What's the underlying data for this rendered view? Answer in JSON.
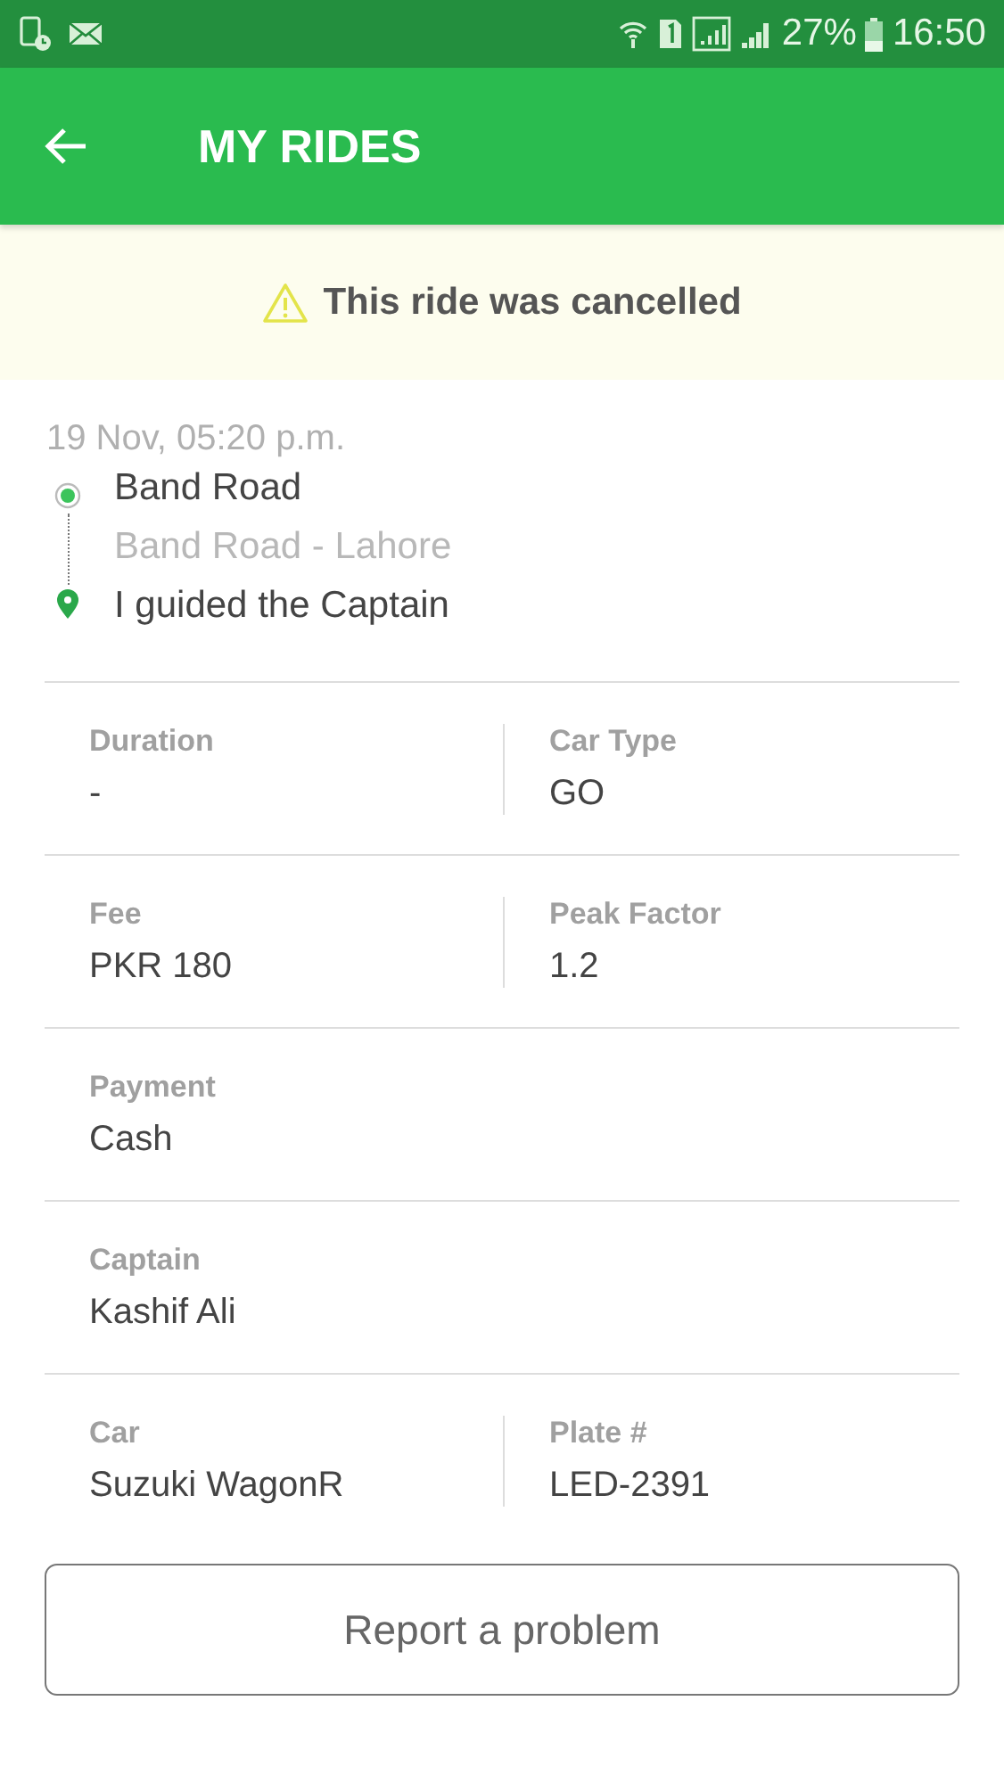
{
  "status_bar": {
    "battery": "27%",
    "time": "16:50"
  },
  "app_bar": {
    "title": "MY RIDES"
  },
  "notice": {
    "text": "This ride was cancelled"
  },
  "ride": {
    "date": "19 Nov, 05:20 p.m.",
    "pickup": "Band Road",
    "pickup_detail": "Band Road - Lahore",
    "dropoff": "I guided the Captain"
  },
  "details": [
    {
      "cells": [
        {
          "label": "Duration",
          "value": "-"
        },
        {
          "label": "Car Type",
          "value": "GO"
        }
      ]
    },
    {
      "cells": [
        {
          "label": "Fee",
          "value": "PKR 180"
        },
        {
          "label": "Peak Factor",
          "value": "1.2"
        }
      ]
    },
    {
      "cells": [
        {
          "label": "Payment",
          "value": "Cash"
        }
      ]
    },
    {
      "cells": [
        {
          "label": "Captain",
          "value": "Kashif Ali"
        }
      ]
    },
    {
      "cells": [
        {
          "label": "Car",
          "value": "Suzuki WagonR"
        },
        {
          "label": "Plate #",
          "value": "LED-2391"
        }
      ]
    }
  ],
  "report_button": "Report a problem"
}
